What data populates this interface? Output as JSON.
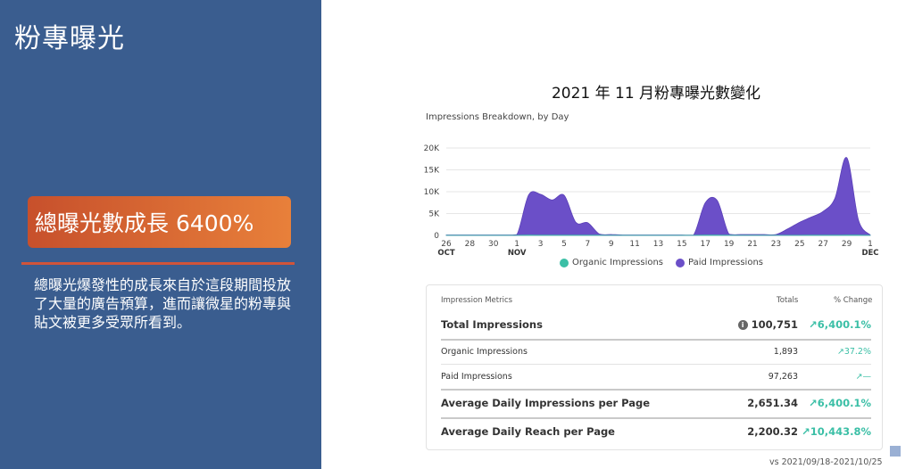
{
  "slide": {
    "title": "粉專曝光",
    "badge": "總曝光數成長 6400%",
    "description": "總曝光爆發性的成長來自於這段期間投放了大量的廣告預算，進而讓微星的粉專與貼文被更多受眾所看到。"
  },
  "chart_title": "2021 年 11 月粉專曝光數變化",
  "chart_data": {
    "type": "area",
    "title": "Impressions Breakdown, by Day",
    "x": [
      "10/26",
      "10/27",
      "10/28",
      "10/29",
      "10/30",
      "10/31",
      "11/01",
      "11/02",
      "11/03",
      "11/04",
      "11/05",
      "11/06",
      "11/07",
      "11/08",
      "11/09",
      "11/10",
      "11/11",
      "11/12",
      "11/13",
      "11/14",
      "11/15",
      "11/16",
      "11/17",
      "11/18",
      "11/19",
      "11/20",
      "11/21",
      "11/22",
      "11/23",
      "11/24",
      "11/25",
      "11/26",
      "11/27",
      "11/28",
      "11/29",
      "11/30",
      "12/01"
    ],
    "tick_labels": [
      "26",
      "28",
      "30",
      "1",
      "3",
      "5",
      "7",
      "9",
      "11",
      "13",
      "15",
      "17",
      "19",
      "21",
      "23",
      "25",
      "27",
      "29",
      "1"
    ],
    "month_labels": [
      {
        "label": "OCT",
        "at": "10/26"
      },
      {
        "label": "NOV",
        "at": "11/01"
      },
      {
        "label": "DEC",
        "at": "12/01"
      }
    ],
    "series": [
      {
        "name": "Organic Impressions",
        "color": "#3bbfa6",
        "values": [
          30,
          30,
          30,
          30,
          30,
          30,
          30,
          60,
          50,
          55,
          50,
          45,
          40,
          35,
          30,
          30,
          30,
          30,
          30,
          30,
          30,
          30,
          60,
          60,
          40,
          30,
          30,
          30,
          30,
          30,
          30,
          40,
          50,
          50,
          60,
          60,
          30
        ]
      },
      {
        "name": "Paid Impressions",
        "color": "#6b4fc8",
        "values": [
          100,
          100,
          100,
          100,
          100,
          100,
          200,
          9300,
          9400,
          8100,
          9200,
          3000,
          2900,
          300,
          200,
          100,
          100,
          100,
          100,
          100,
          100,
          100,
          7500,
          8000,
          300,
          200,
          200,
          200,
          200,
          1500,
          3000,
          4200,
          5500,
          8500,
          17800,
          3500,
          100
        ]
      }
    ],
    "ylim": [
      0,
      20000
    ],
    "yticks": [
      0,
      5000,
      10000,
      15000,
      20000
    ],
    "ytick_labels": [
      "0",
      "5K",
      "10K",
      "15K",
      "20K"
    ],
    "grid": true,
    "legend": "bottom"
  },
  "metrics": {
    "headers": {
      "label": "Impression Metrics",
      "totals": "Totals",
      "change": "% Change"
    },
    "rows": [
      {
        "label": "Total Impressions",
        "total": "100,751",
        "change": "↗6,400.1%",
        "style": "bold",
        "info": "i"
      },
      {
        "label": "Organic Impressions",
        "total": "1,893",
        "change": "↗37.2%",
        "style": "light"
      },
      {
        "label": "Paid Impressions",
        "total": "97,263",
        "change": "↗—",
        "style": "light"
      },
      {
        "label": "Average Daily Impressions per Page",
        "total": "2,651.34",
        "change": "↗6,400.1%",
        "style": "bold"
      },
      {
        "label": "Average Daily Reach per Page",
        "total": "2,200.32",
        "change": "↗10,443.8%",
        "style": "bold"
      }
    ]
  },
  "footer": {
    "vs": "vs 2021/09/18-2021/10/25"
  },
  "colors": {
    "panel": "#3a5d8f",
    "badge_start": "#c7502c",
    "badge_end": "#e8803a",
    "accent_green": "#3bbfa6",
    "paid_purple": "#6b4fc8"
  }
}
